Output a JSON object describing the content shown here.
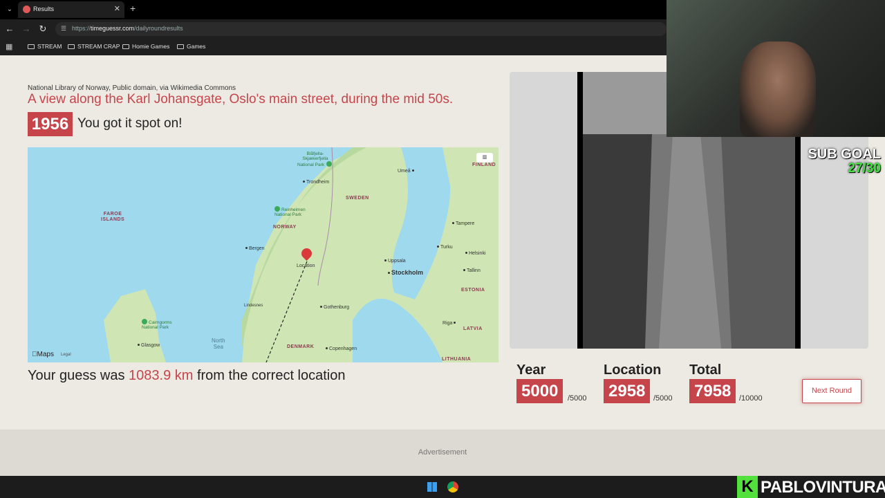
{
  "browser": {
    "tab_title": "Results",
    "url_prefix": "https://",
    "url_domain": "timeguessr.com",
    "url_path": "/dailyroundresults",
    "bookmarks": [
      "STREAM",
      "STREAM CRAP",
      "Homie Games",
      "Games"
    ]
  },
  "result": {
    "credit": "National Library of Norway, Public domain, via Wikimedia Commons",
    "headline": "A view along the Karl Johansgate, Oslo's main street, during the mid 50s.",
    "year": "1956",
    "year_feedback": "You got it spot on!",
    "guess_prefix": "Your guess was ",
    "guess_distance": "1083.9 km",
    "guess_suffix": " from the correct location"
  },
  "map": {
    "pin_label": "Location",
    "labels": {
      "faroe": "FAROE\nISLANDS",
      "norway": "NORWAY",
      "sweden": "SWEDEN",
      "finland": "FINLAND",
      "estonia": "ESTONIA",
      "latvia": "LATVIA",
      "lithuania": "LITHUANIA",
      "denmark": "DENMARK",
      "trondheim": "Trondheim",
      "bergen": "Bergen",
      "stockholm": "Stockholm",
      "uppsala": "Uppsala",
      "umea": "Umeå",
      "tampere": "Tampere",
      "turku": "Turku",
      "helsinki": "Helsinki",
      "tallinn": "Tallinn",
      "riga": "Riga",
      "gothenburg": "Gothenburg",
      "copenhagen": "Copenhagen",
      "glasgow": "Glasgow",
      "lindesnes": "Lindesnes",
      "north_sea": "North\nSea",
      "cairngorms": "Cairngorms\nNational Park",
      "reinheimen": "Reinheimen\nNational Park",
      "blafjella": "Blåfjella-\nSkjækerfjella\nNational Park"
    },
    "attribution": "Maps",
    "legal": "Legal",
    "toggle": "▥"
  },
  "scores": {
    "year_label": "Year",
    "year_value": "5000",
    "year_max": "/5000",
    "location_label": "Location",
    "location_value": "2958",
    "location_max": "/5000",
    "total_label": "Total",
    "total_value": "7958",
    "total_max": "/10000",
    "next_button": "Next Round"
  },
  "ad_label": "Advertisement",
  "overlay": {
    "sub_goal_label": "SUB GOAL",
    "sub_goal_count": "27/30",
    "brand_letter": "K",
    "brand_name": "PABLOVINTURA"
  },
  "colors": {
    "accent": "#c6454b",
    "page_bg": "#eceae3",
    "sub_goal_green": "#3fe23f",
    "brand_green": "#52e03c"
  }
}
